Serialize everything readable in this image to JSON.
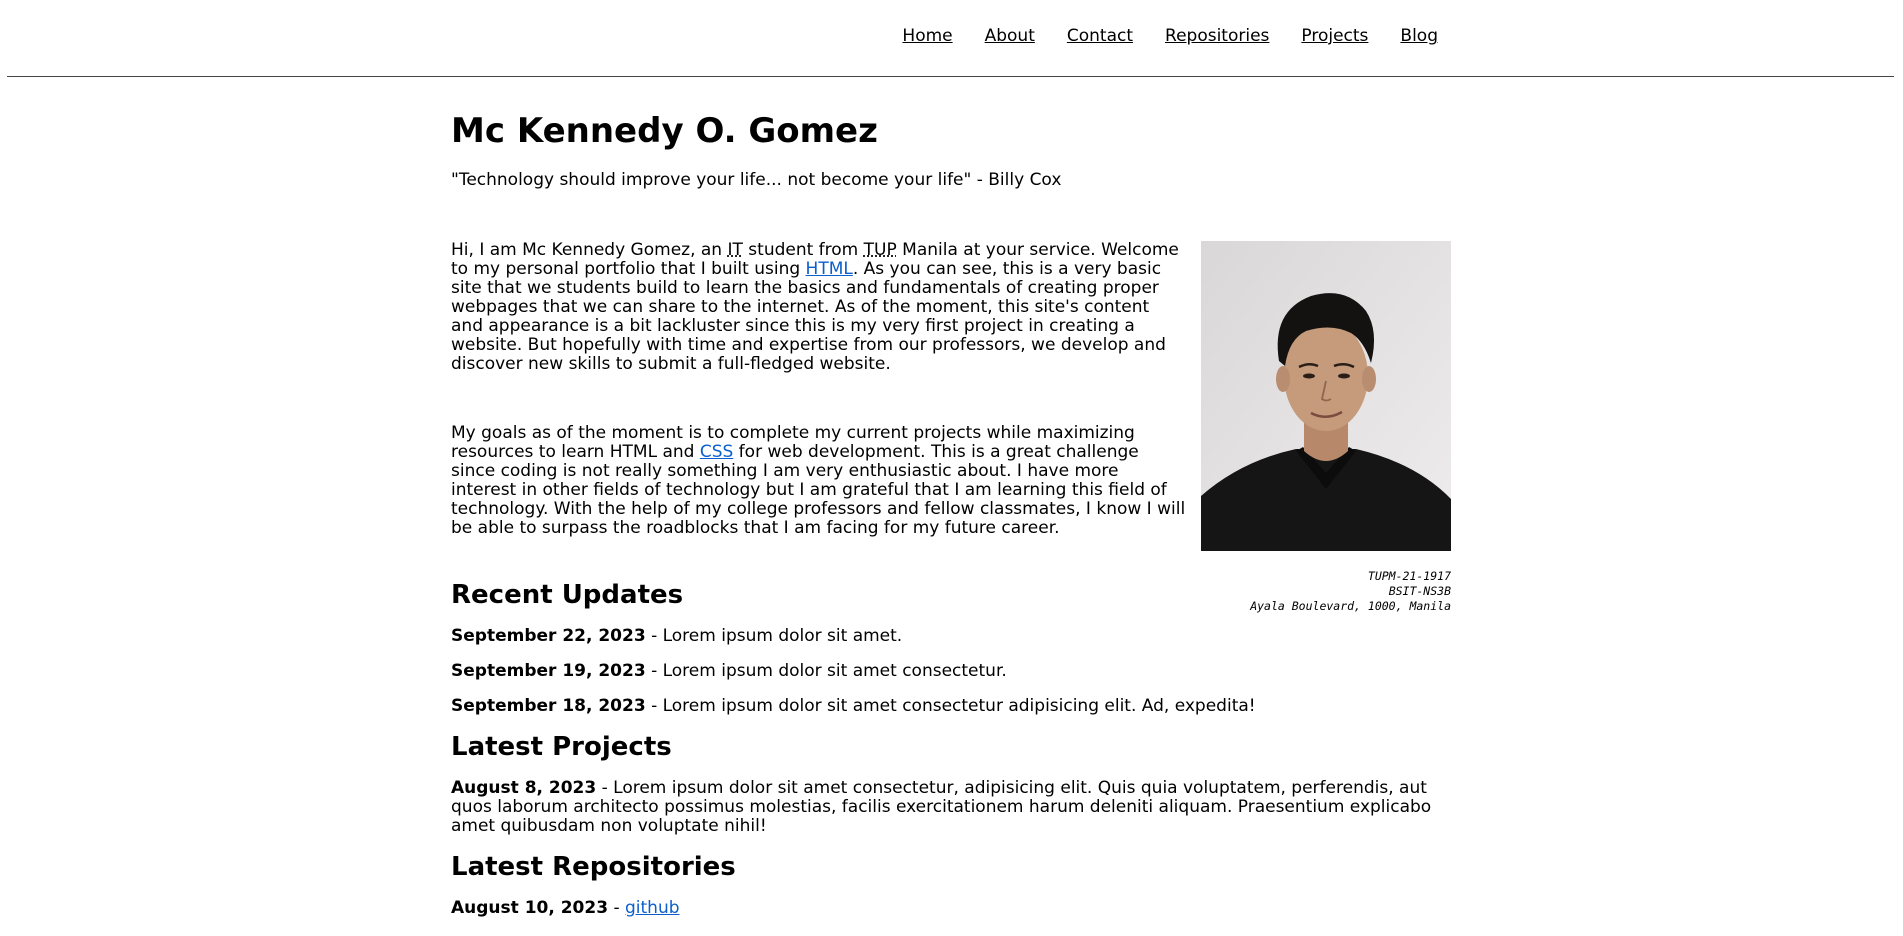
{
  "nav": {
    "items": [
      {
        "label": "Home"
      },
      {
        "label": "About"
      },
      {
        "label": "Contact"
      },
      {
        "label": "Repositories"
      },
      {
        "label": "Projects"
      },
      {
        "label": "Blog"
      }
    ]
  },
  "header": {
    "title": "Mc Kennedy O. Gomez",
    "quote": "\"Technology should improve your life... not become your life\" - Billy Cox"
  },
  "intro": {
    "p1_a": "Hi, I am Mc Kennedy Gomez, an ",
    "p1_abbr1": "IT",
    "p1_b": " student from ",
    "p1_abbr2": "TUP",
    "p1_c": " Manila at your service. Welcome to my personal portfolio that I built using ",
    "p1_link": "HTML",
    "p1_d": ". As you can see, this is a very basic site that we students build to learn the basics and fundamentals of creating proper webpages that we can share to the internet. As of the moment, this site's content and appearance is a bit lackluster since this is my very first project in creating a website. But hopefully with time and expertise from our professors, we develop and discover new skills to submit a full-fledged website.",
    "p2_a": "My goals as of the moment is to complete my current projects while maximizing resources to learn HTML and ",
    "p2_link": "CSS",
    "p2_b": " for web development. This is a great challenge since coding is not really something I am very enthusiastic about. I have more interest in other fields of technology but I am grateful that I am learning this field of technology. With the help of my college professors and fellow classmates, I know I will be able to surpass the roadblocks that I am facing for my future career."
  },
  "profile": {
    "address_lines": [
      "TUPM-21-1917",
      "BSIT-NS3B",
      "Ayala Boulevard, 1000, Manila"
    ]
  },
  "updates": {
    "heading": "Recent Updates",
    "items": [
      {
        "date": "September 22, 2023",
        "text": " - Lorem ipsum dolor sit amet."
      },
      {
        "date": "September 19, 2023",
        "text": " - Lorem ipsum dolor sit amet consectetur."
      },
      {
        "date": "September 18, 2023",
        "text": " - Lorem ipsum dolor sit amet consectetur adipisicing elit. Ad, expedita!"
      }
    ]
  },
  "projects": {
    "heading": "Latest Projects",
    "items": [
      {
        "date": "August 8, 2023",
        "text": " - Lorem ipsum dolor sit amet consectetur, adipisicing elit. Quis quia voluptatem, perferendis, aut quos laborum architecto possimus molestias, facilis exercitationem harum deleniti aliquam. Praesentium explicabo amet quibusdam non voluptate nihil!"
      }
    ]
  },
  "repositories": {
    "heading": "Latest Repositories",
    "items": [
      {
        "date": "August 10, 2023",
        "sep": " - ",
        "link": "github"
      }
    ]
  }
}
